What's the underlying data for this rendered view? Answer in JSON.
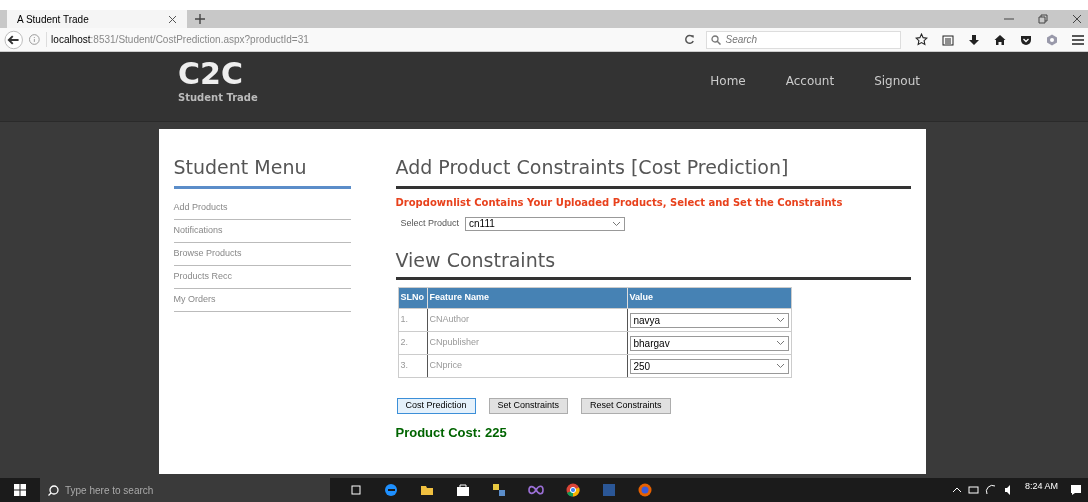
{
  "browser": {
    "tab_title": "A Student Trade",
    "url_host": "localhost",
    "url_rest": ":8531/Student/CostPrediction.aspx?productId=31",
    "search_placeholder": "Search"
  },
  "header": {
    "logo": "C2C",
    "tagline": "Student Trade",
    "nav": [
      "Home",
      "Account",
      "Signout"
    ]
  },
  "sidebar": {
    "title": "Student Menu",
    "items": [
      "Add Products",
      "Notifications",
      "Browse Products",
      "Products Recc",
      "My Orders"
    ]
  },
  "main": {
    "title": "Add Product Constraints [Cost Prediction]",
    "notice": "Dropdownlist Contains Your Uploaded Products, Select and Set the Constraints",
    "select_label": "Select Product",
    "select_value": "cn111",
    "section_title": "View Constraints",
    "table": {
      "columns": [
        "SLNo",
        "Feature Name",
        "Value"
      ],
      "rows": [
        {
          "slno": "1.",
          "feature": "CNAuthor",
          "value": "navya"
        },
        {
          "slno": "2.",
          "feature": "CNpublisher",
          "value": "bhargav"
        },
        {
          "slno": "3.",
          "feature": "CNprice",
          "value": "250"
        }
      ]
    },
    "buttons": [
      {
        "label": "Cost Prediction",
        "selected": true
      },
      {
        "label": "Set Constraints",
        "selected": false
      },
      {
        "label": "Reset Constraints",
        "selected": false
      }
    ],
    "result": "Product Cost: 225"
  },
  "taskbar": {
    "search_placeholder": "Type here to search",
    "time": "8:24 AM"
  }
}
